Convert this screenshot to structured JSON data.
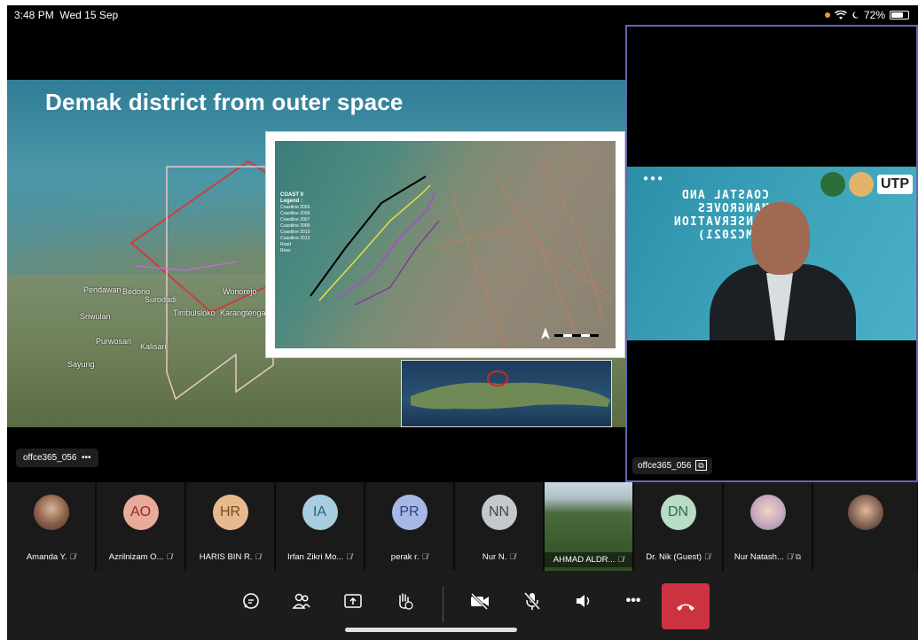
{
  "status_bar": {
    "time": "3:48 PM",
    "date": "Wed 15 Sep",
    "battery": "72%",
    "battery_level": 0.72
  },
  "main_stage": {
    "slide_title": "Demak district from outer space",
    "places": [
      "Pendawan",
      "Bedono",
      "Timbulsloko",
      "Karangtengah",
      "Surodadi",
      "Wonorejo",
      "Sriwulan",
      "Purwosari",
      "Sayung",
      "Kalisari"
    ],
    "legend": {
      "title": "COAST II",
      "subtitle": "Legend :",
      "items": [
        "Coastline 2003",
        "Coastline 2006",
        "Coastline 2007",
        "Coastline 2009",
        "Coastline 2010",
        "Coastline 2013",
        "Road",
        "River"
      ]
    },
    "presenter_label": "offce365_056",
    "more_label": "•••"
  },
  "speaker_tile": {
    "banner_text": "COASTAL AND MANGROVES CONSERVATION (CMC2021)",
    "utp_label": "UTP",
    "name": "offce365_056"
  },
  "participants": [
    {
      "name": "Amanda Y.",
      "initials": "",
      "type": "photo"
    },
    {
      "name": "Azrilnizam O...",
      "initials": "AO",
      "type": "initials",
      "color": "#e9a99b"
    },
    {
      "name": "HARIS BIN R.",
      "initials": "HR",
      "type": "initials",
      "color": "#e8b98e"
    },
    {
      "name": "Irfan Zikri Mo...",
      "initials": "IA",
      "type": "initials",
      "color": "#a6cde0"
    },
    {
      "name": "perak r.",
      "initials": "PR",
      "type": "initials",
      "color": "#a7b7e6"
    },
    {
      "name": "Nur N.",
      "initials": "NN",
      "type": "initials",
      "color": "#c4c8cd"
    },
    {
      "name": "AHMAD ALDR...",
      "initials": "",
      "type": "video"
    },
    {
      "name": "Dr. Nik (Guest)",
      "initials": "DN",
      "type": "initials",
      "color": "#b9dcc6"
    },
    {
      "name": "Nur Natash...",
      "initials": "",
      "type": "photo"
    },
    {
      "name": "",
      "initials": "",
      "type": "photo"
    }
  ],
  "controls": {
    "chat": "chat-icon",
    "participants": "people-icon",
    "share": "share-screen-icon",
    "raise_hand": "raise-hand-icon",
    "camera": "camera-off-icon",
    "mic": "mic-off-icon",
    "speaker": "speaker-icon",
    "more": "•••",
    "hangup": "hang-up-icon",
    "hangup_color": "#cc3340"
  }
}
